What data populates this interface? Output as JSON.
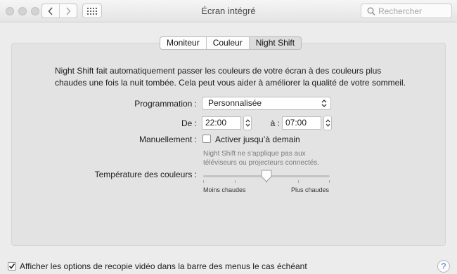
{
  "window": {
    "title": "Écran intégré"
  },
  "toolbar": {
    "back_icon": "chevron-left-icon",
    "forward_icon": "chevron-right-icon",
    "grid_icon": "show-all-grid-icon",
    "search_placeholder": "Rechercher"
  },
  "tabs": [
    {
      "label": "Moniteur",
      "active": false
    },
    {
      "label": "Couleur",
      "active": false
    },
    {
      "label": "Night Shift",
      "active": true
    }
  ],
  "night_shift": {
    "description": "Night Shift fait automatiquement passer les couleurs de votre écran à des couleurs plus chaudes une fois la nuit tombée. Cela peut vous aider à améliorer la qualité de votre sommeil.",
    "schedule_label": "Programmation :",
    "schedule_value": "Personnalisée",
    "from_label": "De :",
    "from_time": "22:00",
    "to_label": "à :",
    "to_time": "07:00",
    "manual_label": "Manuellement :",
    "manual_checkbox_label": "Activer jusqu’à demain",
    "manual_checked": false,
    "hint": "Night Shift ne s’applique pas aux téléviseurs ou projecteurs connectés.",
    "temperature_label": "Température des couleurs :",
    "temperature_min_label": "Moins chaudes",
    "temperature_max_label": "Plus chaudes",
    "temperature_level": 0.5
  },
  "footer": {
    "mirroring_label": "Afficher les options de recopie vidéo dans la barre des menus le cas échéant",
    "mirroring_checked": true,
    "help_label": "?"
  }
}
